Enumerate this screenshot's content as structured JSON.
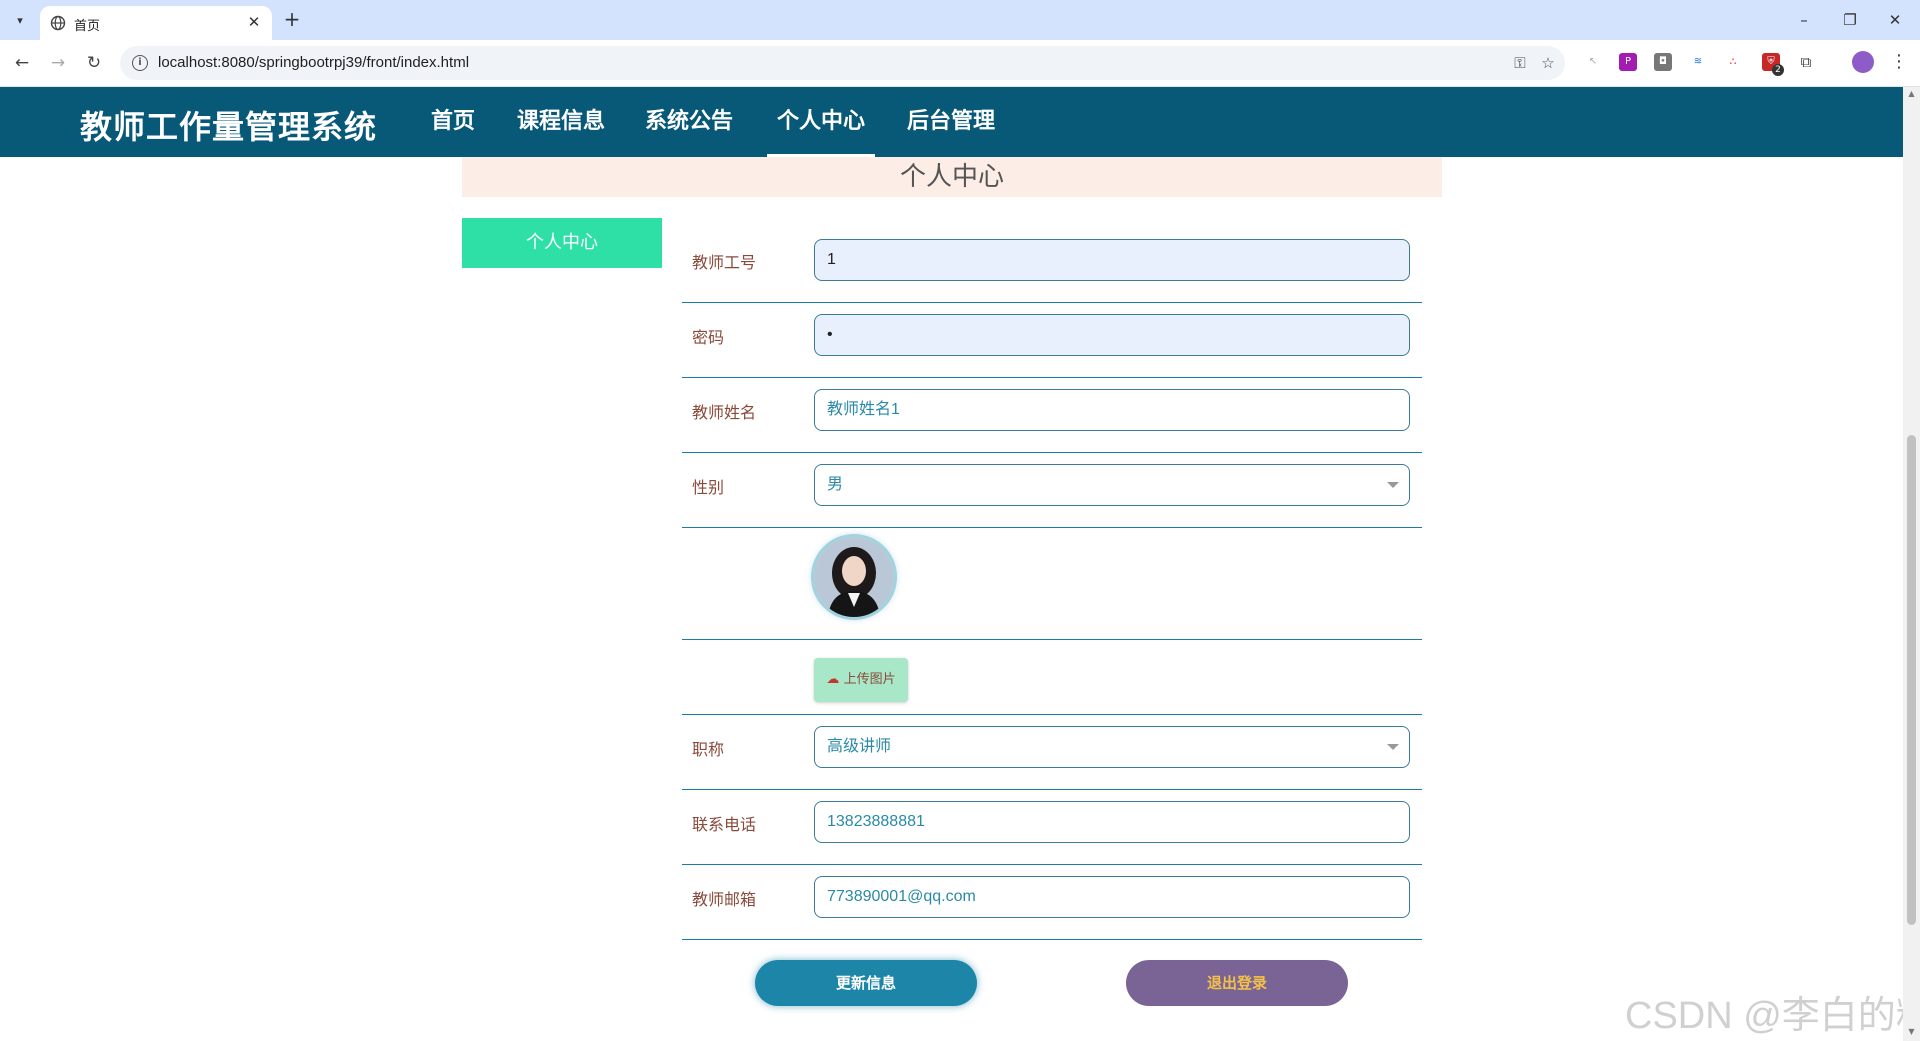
{
  "browser": {
    "tab_title": "首页",
    "url": "localhost:8080/springbootrpj39/front/index.html",
    "extension_badge": "2"
  },
  "site": {
    "title": "教师工作量管理系统",
    "nav": [
      "首页",
      "课程信息",
      "系统公告",
      "个人中心",
      "后台管理"
    ],
    "active_nav": "个人中心"
  },
  "page": {
    "banner_title": "个人中心",
    "side_menu": [
      "个人中心"
    ]
  },
  "form": {
    "teacher_id_label": "教师工号",
    "teacher_id_value": "1",
    "password_label": "密码",
    "password_value": "•",
    "name_label": "教师姓名",
    "name_value": "教师姓名1",
    "gender_label": "性别",
    "gender_value": "男",
    "upload_label": "上传图片",
    "title_label": "职称",
    "title_value": "高级讲师",
    "phone_label": "联系电话",
    "phone_value": "13823888881",
    "email_label": "教师邮箱",
    "email_value": "773890001@qq.com"
  },
  "actions": {
    "update_label": "更新信息",
    "logout_label": "退出登录"
  },
  "watermark": "CSDN @李白的粉",
  "colors": {
    "header_bg": "#085878",
    "side_menu_bg": "#2ee0a6",
    "banner_bg": "#fcede6",
    "update_btn": "#1d86a8",
    "logout_btn": "#7a6495"
  }
}
